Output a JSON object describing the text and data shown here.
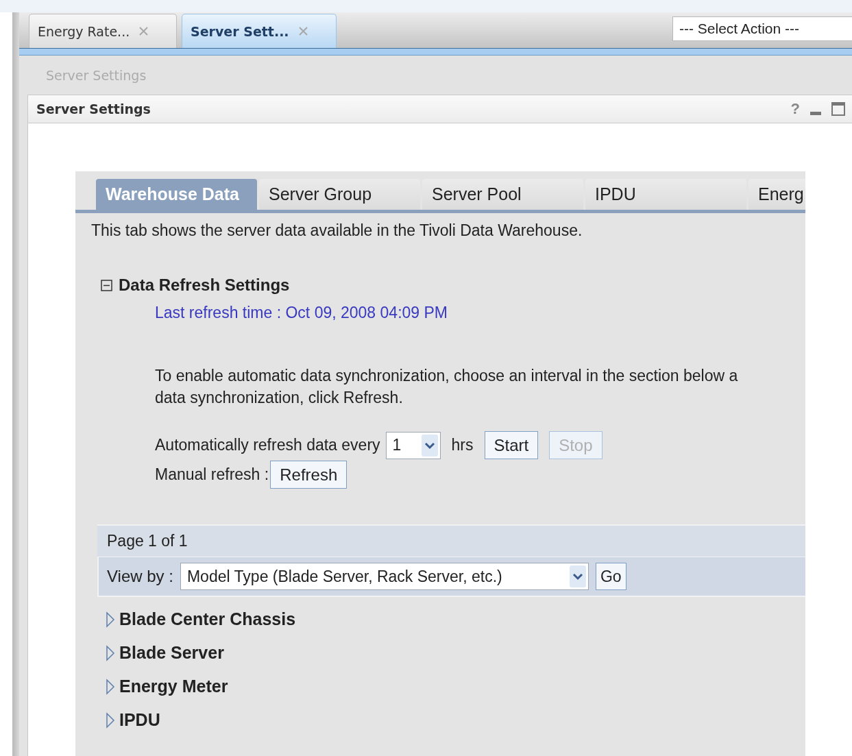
{
  "top_tabs": [
    {
      "label": "Energy Rate...",
      "selected": false
    },
    {
      "label": "Server Sett...",
      "selected": true
    }
  ],
  "action_select": {
    "value": "--- Select Action ---"
  },
  "breadcrumb": "Server Settings",
  "portlet": {
    "title": "Server Settings",
    "help": "?"
  },
  "tabs": [
    {
      "label": "Warehouse Data",
      "selected": true
    },
    {
      "label": "Server Group",
      "selected": false
    },
    {
      "label": "Server Pool",
      "selected": false
    },
    {
      "label": "IPDU",
      "selected": false
    },
    {
      "label": "Energ",
      "selected": false
    }
  ],
  "description": "This tab shows the server data available in the Tivoli Data Warehouse.",
  "section": {
    "title": "Data Refresh Settings",
    "expanded": true,
    "last_refresh": "Last refresh time : Oct 09, 2008 04:09 PM",
    "instructions": [
      "To enable automatic data synchronization, choose an interval in the section below a",
      "data synchronization, click Refresh."
    ]
  },
  "auto_refresh": {
    "label": "Automatically refresh data every",
    "interval": "1",
    "unit": "hrs",
    "buttons": [
      {
        "label": "Start",
        "disabled": false
      },
      {
        "label": "Stop",
        "disabled": true
      }
    ]
  },
  "manual_refresh": {
    "label": "Manual refresh :",
    "button": "Refresh"
  },
  "pager": {
    "page": "Page 1 of 1",
    "view_by_label": "View by :",
    "view_by_value": "Model Type (Blade Server, Rack Server, etc.)",
    "go": "Go"
  },
  "groups": [
    {
      "label": "Blade Center Chassis",
      "expanded": false
    },
    {
      "label": "Blade Server",
      "expanded": false
    },
    {
      "label": "Energy Meter",
      "expanded": false
    },
    {
      "label": "IPDU",
      "expanded": false
    }
  ]
}
